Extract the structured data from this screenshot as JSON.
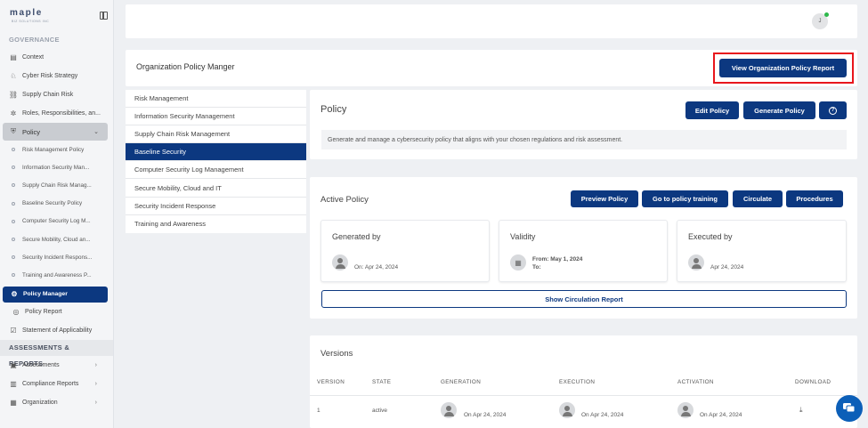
{
  "sidebar": {
    "logo": "maple",
    "logo_sub": "BIZ SOLUTIONS INC",
    "governance_label": "GOVERNANCE",
    "items": [
      {
        "label": "Context"
      },
      {
        "label": "Cyber Risk Strategy"
      },
      {
        "label": "Supply Chain Risk"
      },
      {
        "label": "Roles, Responsibilities, an..."
      }
    ],
    "policy_label": "Policy",
    "policy_subitems": [
      {
        "label": "Risk Management Policy"
      },
      {
        "label": "Information Security Man..."
      },
      {
        "label": "Supply Chain Risk Manag..."
      },
      {
        "label": "Baseline Security Policy"
      },
      {
        "label": "Computer Security Log M..."
      },
      {
        "label": "Secure Mobility, Cloud an..."
      },
      {
        "label": "Security Incident Respons..."
      },
      {
        "label": "Training and Awareness P..."
      }
    ],
    "policy_manager": "Policy Manager",
    "policy_report": "Policy Report",
    "statement": "Statement of Applicability",
    "assessments_label": "ASSESSMENTS & REPORTS",
    "assessments": "Assessments",
    "compliance_reports": "Compliance Reports",
    "organization": "Organization"
  },
  "topbar": {
    "avatar_initial": "J"
  },
  "org_header": {
    "title": "Organization Policy Manger",
    "view_report_button": "View Organization Policy Report"
  },
  "policy_list": [
    {
      "label": "Risk Management"
    },
    {
      "label": "Information Security Management"
    },
    {
      "label": "Supply Chain Risk Management"
    },
    {
      "label": "Baseline Security"
    },
    {
      "label": "Computer Security Log Management"
    },
    {
      "label": "Secure Mobility, Cloud and IT"
    },
    {
      "label": "Security Incident Response"
    },
    {
      "label": "Training and Awareness"
    }
  ],
  "policy_card": {
    "title": "Policy",
    "edit_button": "Edit Policy",
    "generate_button": "Generate Policy",
    "help_icon": "?",
    "description": "Generate and manage a cybersecurity policy that aligns with your chosen regulations and risk assessment."
  },
  "active_policy": {
    "title": "Active Policy",
    "preview_button": "Preview Policy",
    "training_button": "Go to policy training",
    "circulate_button": "Circulate",
    "procedures_button": "Procedures",
    "generated_by": {
      "title": "Generated by",
      "text": "On: Apr 24, 2024"
    },
    "validity": {
      "title": "Validity",
      "from": "From: May 1, 2024",
      "to": "To:"
    },
    "executed_by": {
      "title": "Executed by",
      "text": "Apr 24, 2024"
    },
    "circulation_button": "Show Circulation Report"
  },
  "versions": {
    "title": "Versions",
    "headers": [
      "VERSION",
      "STATE",
      "GENERATION",
      "EXECUTION",
      "ACTIVATION",
      "DOWNLOAD"
    ],
    "rows": [
      {
        "version": "1",
        "state": "active",
        "generation": "On Apr 24, 2024",
        "execution": "On Apr 24, 2024",
        "activation": "On Apr 24, 2024"
      }
    ]
  },
  "colors": {
    "primary": "#0c3880",
    "highlight": "#e8161c",
    "online": "#2eb84b"
  }
}
